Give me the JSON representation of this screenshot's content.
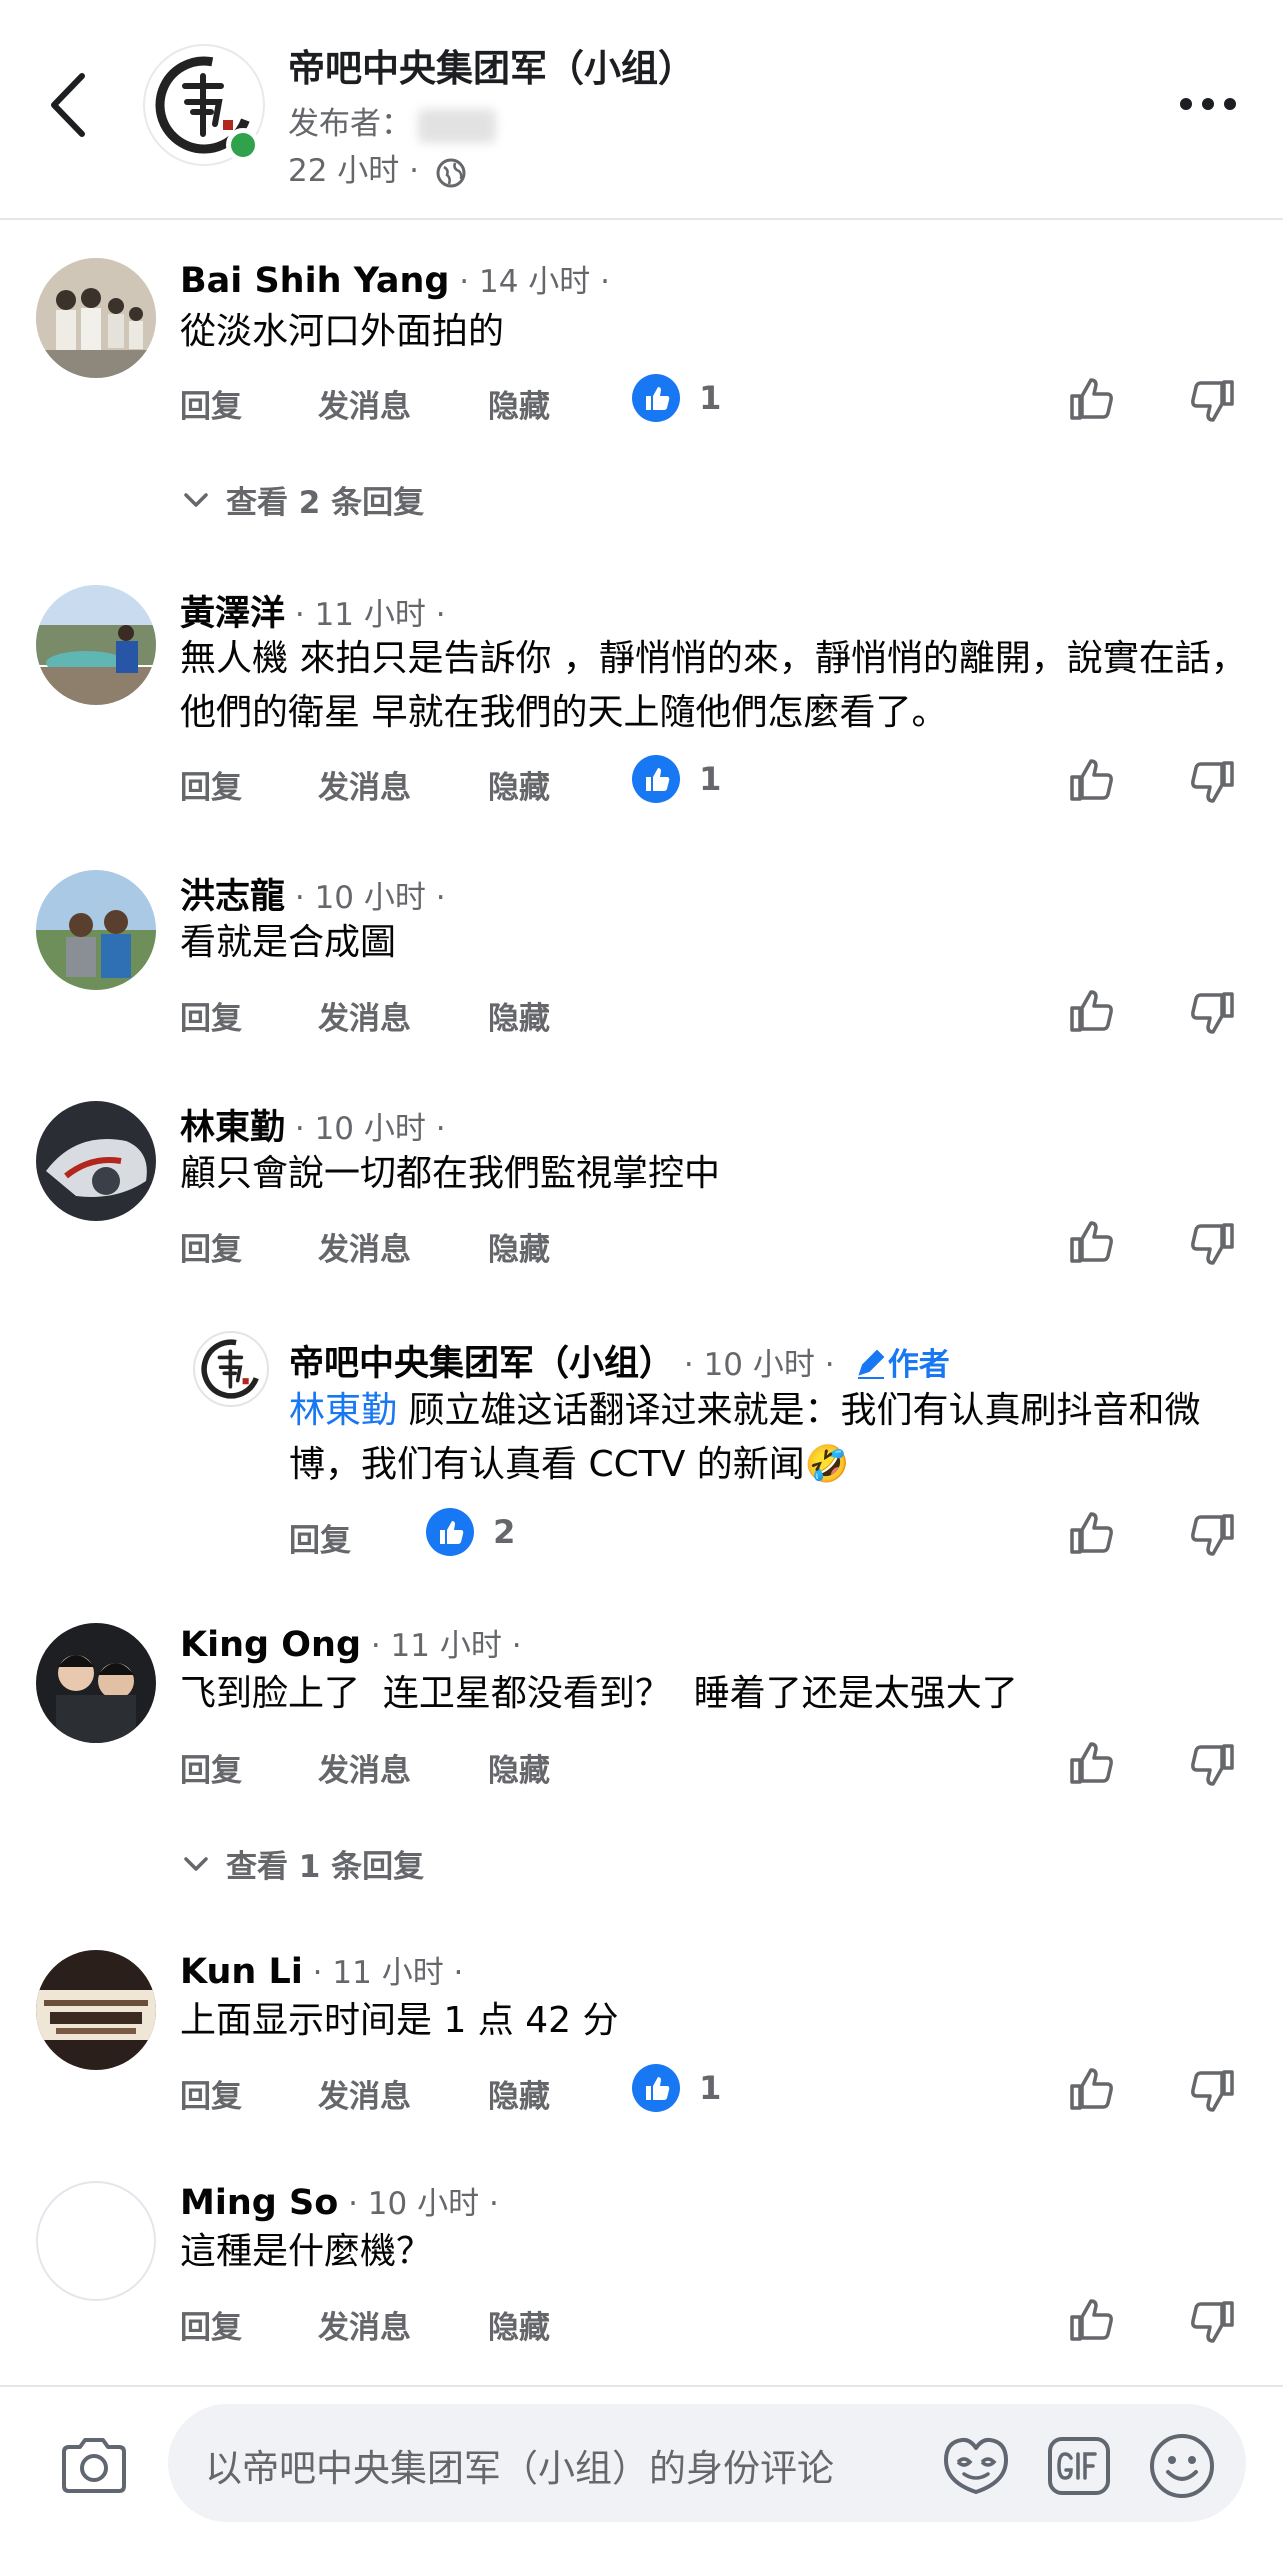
{
  "header": {
    "group_name": "帝吧中央集团军（小组）",
    "poster_label": "发布者：",
    "time": "22 小时 · "
  },
  "comments": [
    {
      "name": "Bai Shih Yang",
      "meta": " · 14 小时 ·",
      "text": "從淡水河口外面拍的",
      "reply": "回复",
      "message": "发消息",
      "hide": "隐藏",
      "likes": "1",
      "view_replies": "查看 2 条回复"
    },
    {
      "name": "黃澤洋",
      "meta": " · 11 小时 ·",
      "text": "無人機 來拍只是告訴你 ，靜悄悄的來，靜悄悄的離開，說實在話，他們的衛星 早就在我們的天上隨他們怎麼看了。",
      "reply": "回复",
      "message": "发消息",
      "hide": "隐藏",
      "likes": "1"
    },
    {
      "name": "洪志龍",
      "meta": " · 10 小时 ·",
      "text": "看就是合成圖",
      "reply": "回复",
      "message": "发消息",
      "hide": "隐藏"
    },
    {
      "name": "林東勤",
      "meta": " · 10 小时 ·",
      "text": "顧只會說一切都在我們監視掌控中",
      "reply": "回复",
      "message": "发消息",
      "hide": "隐藏"
    },
    {
      "name": "King Ong",
      "meta": " · 11 小时 ·",
      "text": "飞到脸上了  连卫星都没看到？  睡着了还是太强大了",
      "reply": "回复",
      "message": "发消息",
      "hide": "隐藏",
      "view_replies": "查看 1 条回复"
    },
    {
      "name": "Kun Li",
      "meta": " · 11 小时 ·",
      "text": "上面显示时间是 1 点 42 分",
      "reply": "回复",
      "message": "发消息",
      "hide": "隐藏",
      "likes": "1"
    },
    {
      "name": "Ming So",
      "meta": " · 10 小时 ·",
      "text": "這種是什麼機？",
      "reply": "回复",
      "message": "发消息",
      "hide": "隐藏"
    }
  ],
  "author_reply": {
    "name": "帝吧中央集团军（小组）",
    "meta": " · 10 小时 ·",
    "author_label": "作者",
    "mention": "林東勤",
    "text": " 顾立雄这话翻译过来就是：我们有认真刷抖音和微博，我们有认真看 CCTV 的新闻",
    "emoji": "🤣",
    "reply": "回复",
    "likes": "2"
  },
  "composer": {
    "placeholder": "以帝吧中央集团军（小组）的身份评论"
  },
  "colors": {
    "accent": "#1877f2",
    "secondary_text": "#65676b",
    "online": "#31a24c"
  },
  "icons": [
    "back-arrow-icon",
    "more-icon",
    "globe-icon",
    "like-bubble-icon",
    "thumbs-up-icon",
    "thumbs-down-icon",
    "chevron-down-icon",
    "pencil-icon",
    "camera-icon",
    "sticker-icon",
    "gif-icon",
    "smiley-icon"
  ]
}
